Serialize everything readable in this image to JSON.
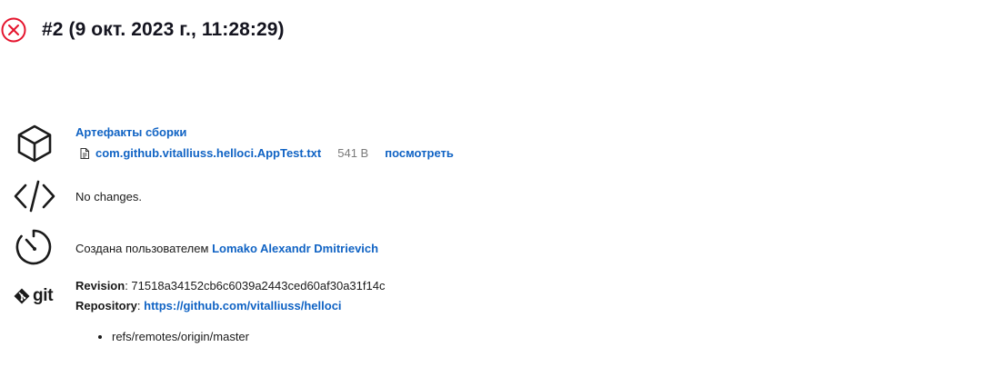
{
  "build": {
    "title": "#2 (9 окт. 2023 г., 11:28:29)",
    "status_icon": "failed-icon",
    "status_color": "#e5142d"
  },
  "artifacts": {
    "icon": "package-icon",
    "title": "Артефакты сборки",
    "file_icon": "file-icon",
    "file_name": "com.github.vitalliuss.helloci.AppTest.txt",
    "file_size": "541 B",
    "view_label": "посмотреть"
  },
  "changes": {
    "icon": "code-icon",
    "text": "No changes."
  },
  "cause": {
    "icon": "timer-icon",
    "prefix": "Создана пользователем",
    "user": "Lomako Alexandr Dmitrievich"
  },
  "git": {
    "icon": "git-icon",
    "logo_text": "git",
    "revision_label": "Revision",
    "revision_value": "71518a34152cb6c6039a2443ced60af30a31f14c",
    "repository_label": "Repository",
    "repository_url": "https://github.com/vitalliuss/helloci",
    "branches": [
      "refs/remotes/origin/master"
    ]
  },
  "colors": {
    "link": "#1063c4",
    "muted": "#7a7a7a",
    "text": "#1a1a1a"
  }
}
